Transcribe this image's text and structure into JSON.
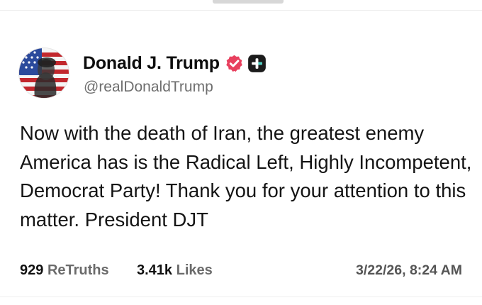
{
  "post": {
    "author": {
      "display_name": "Donald J. Trump",
      "handle": "@realDonaldTrump",
      "verified_badge_color": "#e8405e",
      "badge_icon": "verified-badge-icon",
      "extra_icon": "plus-badge-icon"
    },
    "text": "Now with the death of Iran, the greatest enemy America has is the Radical Left, Highly Incompetent, Democrat Party! Thank you for your attention to this matter. President DJT",
    "stats": {
      "retruths_count": "929",
      "retruths_label": "ReTruths",
      "likes_count": "3.41k",
      "likes_label": "Likes"
    },
    "timestamp": "3/22/26, 8:24 AM"
  },
  "colors": {
    "text": "#111111",
    "muted": "#6e6e6e",
    "badge": "#e8405e",
    "plus_bg": "#1c1c1c"
  }
}
